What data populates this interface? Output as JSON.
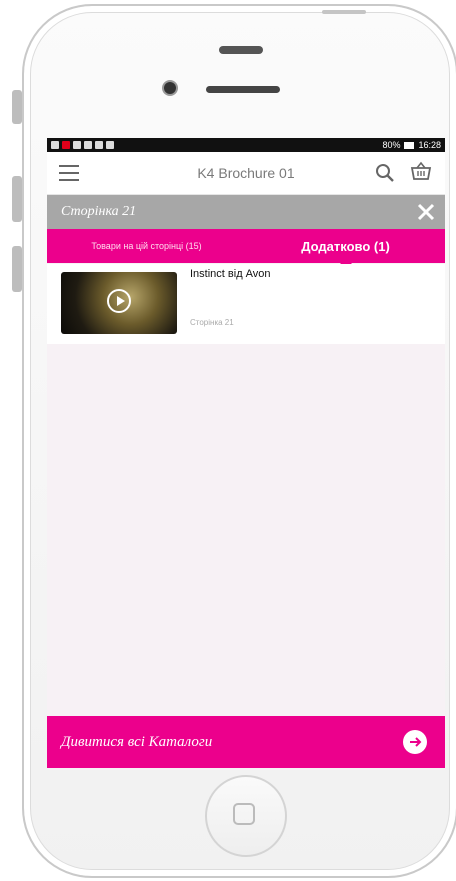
{
  "statusbar": {
    "time": "16:28",
    "battery": "80%"
  },
  "appbar": {
    "title": "K4 Brochure 01"
  },
  "pagebar": {
    "title": "Сторінка 21"
  },
  "tabs": [
    {
      "label": "Товари на цій сторінці (15)",
      "active": false
    },
    {
      "label": "Додатково (1)",
      "active": true
    }
  ],
  "item": {
    "title": "Instinct від Avon",
    "page": "Сторінка 21"
  },
  "footer": {
    "label": "Дивитися всі Каталоги"
  },
  "colors": {
    "accent": "#ec008c",
    "gray_bar": "#a7a7a7",
    "background": "#f7f1f5"
  },
  "icons": [
    "menu-icon",
    "search-icon",
    "basket-icon",
    "close-icon",
    "play-icon",
    "arrow-right-icon",
    "home-button"
  ]
}
